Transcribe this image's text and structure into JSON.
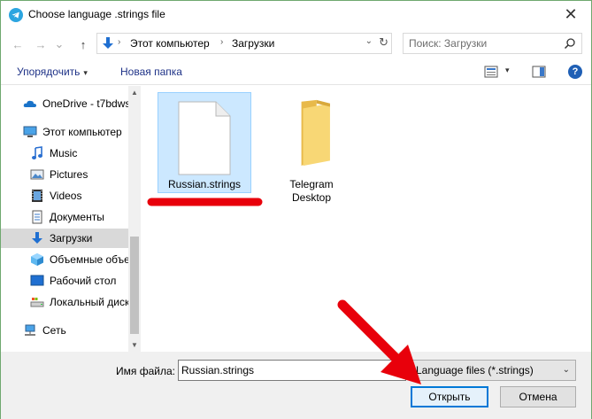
{
  "window": {
    "title": "Choose language .strings file",
    "close_glyph": "✕"
  },
  "address_bar": {
    "back_glyph": "←",
    "forward_glyph": "→",
    "recent_glyph": "⌄",
    "up_glyph": "↑",
    "breadcrumbs": [
      "Этот компьютер",
      "Загрузки"
    ],
    "separator_glyph": "›",
    "dropdown_glyph": "⌄",
    "refresh_glyph": "↻"
  },
  "search": {
    "placeholder": "Поиск: Загрузки"
  },
  "toolbar": {
    "organize_label": "Упорядочить",
    "caret_glyph": "▾",
    "new_folder_label": "Новая папка",
    "help_glyph": "?"
  },
  "sidebar": {
    "items": [
      {
        "label": "OneDrive - t7bdws",
        "icon": "onedrive-icon"
      },
      {
        "label": "Этот компьютер",
        "icon": "computer-icon"
      },
      {
        "label": "Music",
        "icon": "music-icon"
      },
      {
        "label": "Pictures",
        "icon": "pictures-icon"
      },
      {
        "label": "Videos",
        "icon": "videos-icon"
      },
      {
        "label": "Документы",
        "icon": "documents-icon"
      },
      {
        "label": "Загрузки",
        "icon": "downloads-icon"
      },
      {
        "label": "Объемные объекты",
        "icon": "3d-objects-icon"
      },
      {
        "label": "Рабочий стол",
        "icon": "desktop-icon"
      },
      {
        "label": "Локальный диск",
        "icon": "local-disk-icon"
      },
      {
        "label": "Сеть",
        "icon": "network-icon"
      }
    ],
    "selected_index": 6,
    "scroll_up_glyph": "▲",
    "scroll_down_glyph": "▼"
  },
  "files": [
    {
      "name": "Russian.strings",
      "type": "file",
      "selected": true
    },
    {
      "name_line1": "Telegram",
      "name_line2": "Desktop",
      "type": "folder",
      "selected": false
    }
  ],
  "footer": {
    "filename_label": "Имя файла:",
    "filename_value": "Russian.strings",
    "filetype_value": "Language files (*.strings)",
    "filetype_caret": "⌄",
    "open_label": "Открыть",
    "cancel_label": "Отмена"
  },
  "colors": {
    "selection_bg": "#cce8ff",
    "annotation_red": "#e8000b",
    "folder_yellow": "#f8d775",
    "accent_blue": "#0078d7"
  }
}
